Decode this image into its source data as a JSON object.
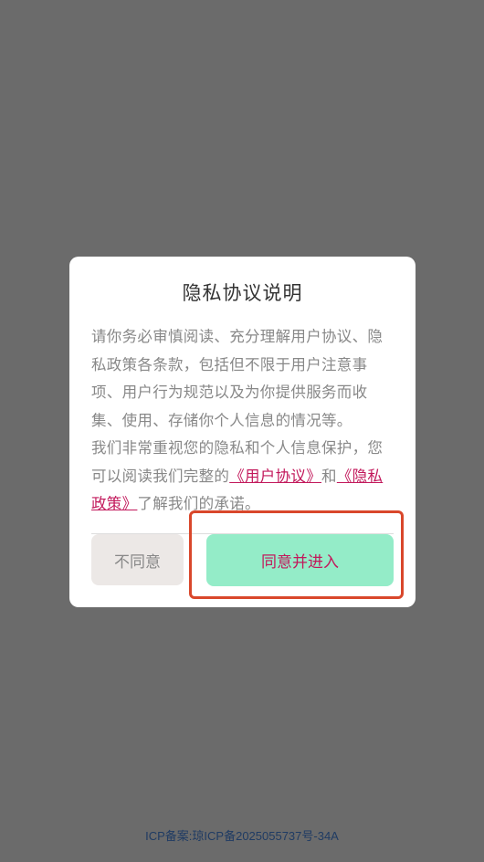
{
  "dialog": {
    "title": "隐私协议说明",
    "paragraph1": "请你务必审慎阅读、充分理解用户协议、隐私政策各条款，包括但不限于用户注意事项、用户行为规范以及为你提供服务而收集、使用、存储你个人信息的情况等。",
    "paragraph2_prefix": "我们非常重视您的隐私和个人信息保护，您可以阅读我们完整的",
    "user_agreement_link": "《用户协议》",
    "and_text": "和",
    "privacy_policy_link": "《隐私政策》",
    "paragraph2_suffix": "了解我们的承诺。",
    "disagree_label": "不同意",
    "agree_label": "同意并进入"
  },
  "footer": {
    "icp_text": "ICP备案:琼ICP备2025055737号-34A"
  },
  "colors": {
    "overlay": "#6b6b6b",
    "link": "#c2185b",
    "agree_button_bg": "#94ecc8",
    "disagree_button_bg": "#ece8e6",
    "highlight_border": "#d9472b"
  }
}
